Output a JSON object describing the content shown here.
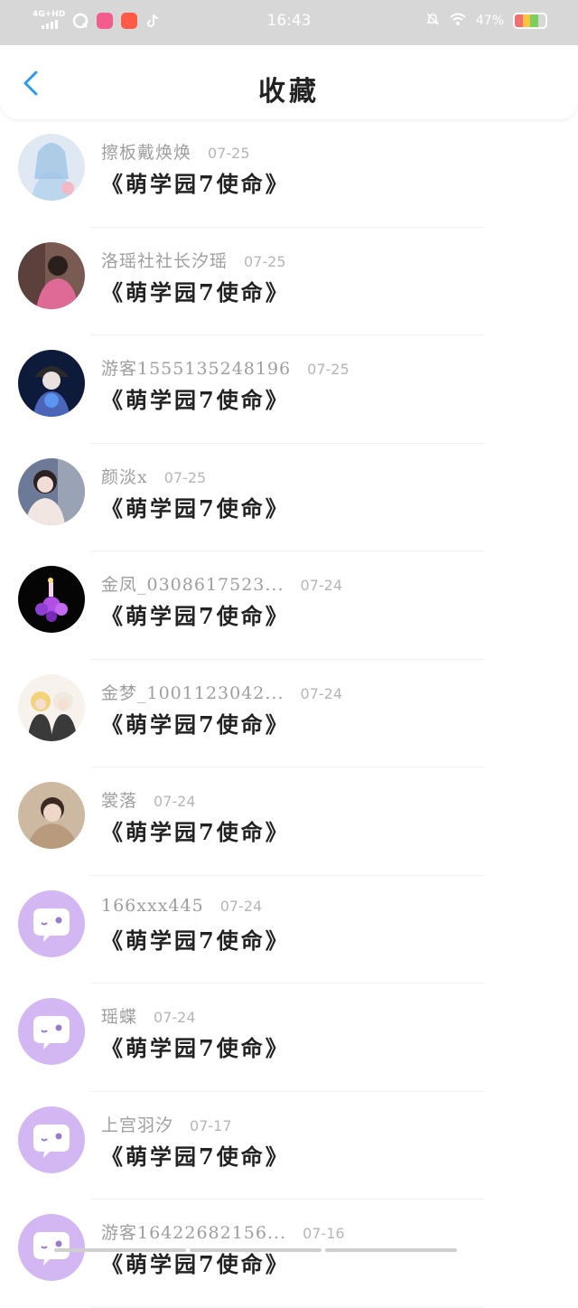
{
  "status_bar": {
    "network": "4G+HD",
    "time": "16:43",
    "battery": "47%",
    "apps": [
      {
        "icon": "qq-browser-icon",
        "color": "#ffffff"
      },
      {
        "icon": "bilibili-app-icon",
        "color": "#f25d8e"
      },
      {
        "icon": "xiaohongshu-app-icon",
        "color": "#ff5a45"
      },
      {
        "icon": "tiktok-icon",
        "color": "#ffffff"
      }
    ]
  },
  "header": {
    "title": "收藏",
    "back_icon": "chevron-left-icon"
  },
  "colors": {
    "accent": "#2b9af3",
    "name_gray": "#9e9e9e",
    "title": "#222222"
  },
  "items": [
    {
      "name": "擦板戴焕焕",
      "date": "07-25",
      "work": "《萌学园7使命》",
      "avatar": "photo-ice-blue"
    },
    {
      "name": "洛瑶社社长汐瑶",
      "date": "07-25",
      "work": "《萌学园7使命》",
      "avatar": "photo-pink"
    },
    {
      "name": "游客1555135248196",
      "date": "07-25",
      "work": "《萌学园7使命》",
      "avatar": "photo-night-blue"
    },
    {
      "name": "颜淡x",
      "date": "07-25",
      "work": "《萌学园7使命》",
      "avatar": "photo-girl"
    },
    {
      "name": "金凤_0308617523...",
      "date": "07-24",
      "work": "《萌学园7使命》",
      "avatar": "photo-purple-flower"
    },
    {
      "name": "金梦_1001123042...",
      "date": "07-24",
      "work": "《萌学园7使命》",
      "avatar": "photo-anime"
    },
    {
      "name": "裳落",
      "date": "07-24",
      "work": "《萌学园7使命》",
      "avatar": "photo-boy"
    },
    {
      "name": "166xxx445",
      "date": "07-24",
      "work": "《萌学园7使命》",
      "avatar": "default-chat"
    },
    {
      "name": "瑶蝶",
      "date": "07-24",
      "work": "《萌学园7使命》",
      "avatar": "default-chat"
    },
    {
      "name": "上宫羽汐",
      "date": "07-17",
      "work": "《萌学园7使命》",
      "avatar": "default-chat"
    },
    {
      "name": "游客16422682156...",
      "date": "07-16",
      "work": "《萌学园7使命》",
      "avatar": "default-chat"
    }
  ]
}
